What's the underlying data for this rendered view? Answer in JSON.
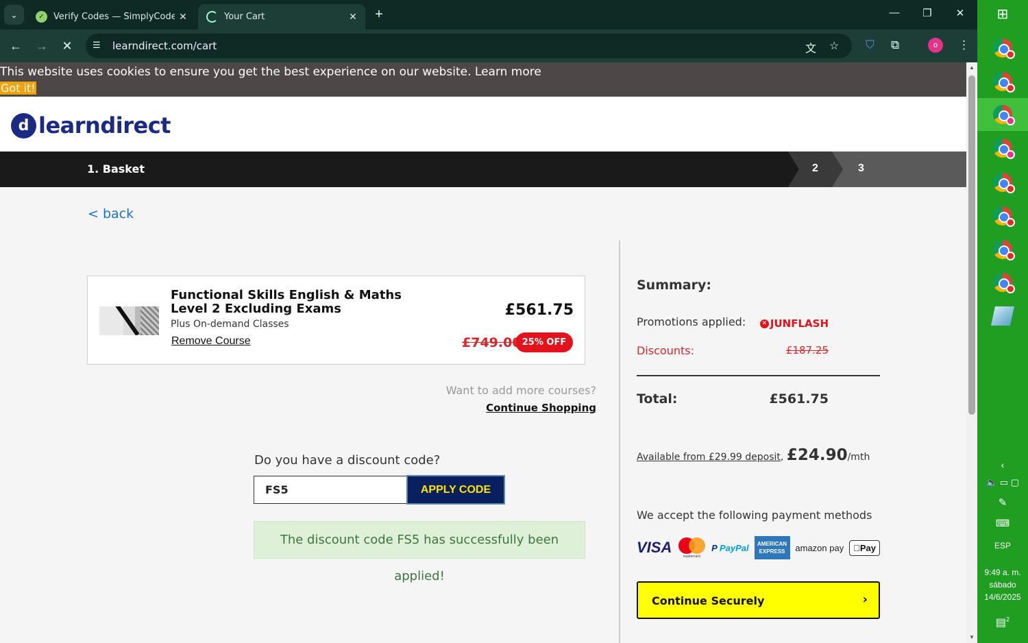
{
  "browser": {
    "tabs": [
      {
        "title": "Verify Codes — SimplyCodes",
        "active": false
      },
      {
        "title": "Your Cart",
        "active": true
      }
    ],
    "url": "learndirect.com/cart",
    "profile_initial": "o"
  },
  "cookie_banner": {
    "message": "This website uses cookies to ensure you get the best experience on our website.",
    "learn_more": "Learn more",
    "got_it": "Got it!"
  },
  "brand": {
    "logo_mark": "d",
    "name": "learndirect",
    "color": "#1b2a82"
  },
  "steps": {
    "current": "1. Basket",
    "step2": "2",
    "step3": "3"
  },
  "back_link": "< back",
  "cart_item": {
    "title": "Functional Skills English & Maths Level 2 Excluding Exams",
    "subtitle": "Plus On-demand Classes",
    "remove": "Remove Course",
    "price": "£561.75",
    "old_price": "£749.00",
    "badge": "25% OFF"
  },
  "more_courses": {
    "question": "Want to add more courses?",
    "link": "Continue Shopping"
  },
  "discount": {
    "question": "Do you have a discount code?",
    "code_value": "FS5",
    "apply_label": "APPLY CODE",
    "success_message": "The discount code FS5 has successfully been applied!"
  },
  "summary": {
    "title": "Summary:",
    "promo_label": "Promotions applied:",
    "promo_code": "JUNFLASH",
    "discount_label": "Discounts:",
    "discount_value": "£187.25",
    "total_label": "Total:",
    "total_value": "£561.75",
    "finance_link": "Available from £29.99 deposit",
    "finance_amount": "£24.90",
    "finance_unit": "/mth",
    "payment_text": "We accept the following payment methods",
    "payment_methods": [
      "VISA",
      "mastercard",
      "PayPal",
      "AMERICAN EXPRESS",
      "amazon pay",
      "Pay"
    ],
    "continue_label": "Continue Securely"
  },
  "taskbar": {
    "language": "ESP",
    "time": "9:49 a. m.",
    "day": "sábado",
    "date": "14/6/2025",
    "notifications": "2"
  }
}
